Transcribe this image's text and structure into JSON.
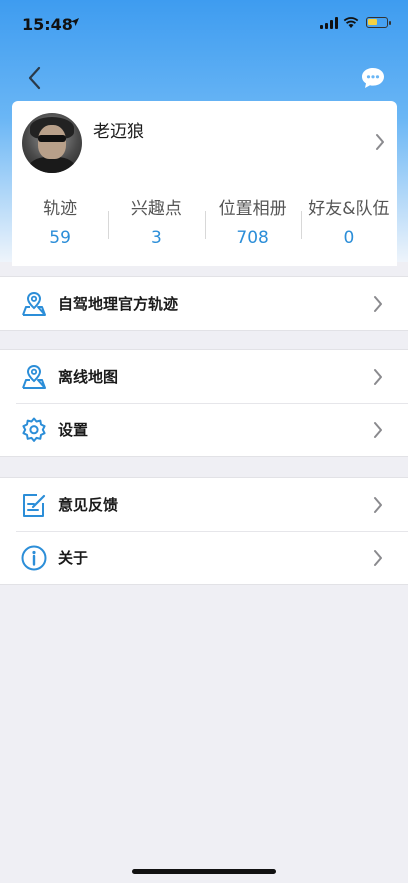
{
  "status_bar": {
    "time": "15:48"
  },
  "profile": {
    "name": "老迈狼",
    "stats": [
      {
        "label": "轨迹",
        "value": "59"
      },
      {
        "label": "兴趣点",
        "value": "3"
      },
      {
        "label": "位置相册",
        "value": "708"
      },
      {
        "label": "好友&队伍",
        "value": "0"
      }
    ]
  },
  "menu": {
    "official_tracks": "自驾地理官方轨迹",
    "offline_map": "离线地图",
    "settings": "设置",
    "feedback": "意见反馈",
    "about": "关于"
  },
  "colors": {
    "accent": "#2c8ed8",
    "header_top": "#3e9cf0",
    "background": "#efeff4"
  }
}
